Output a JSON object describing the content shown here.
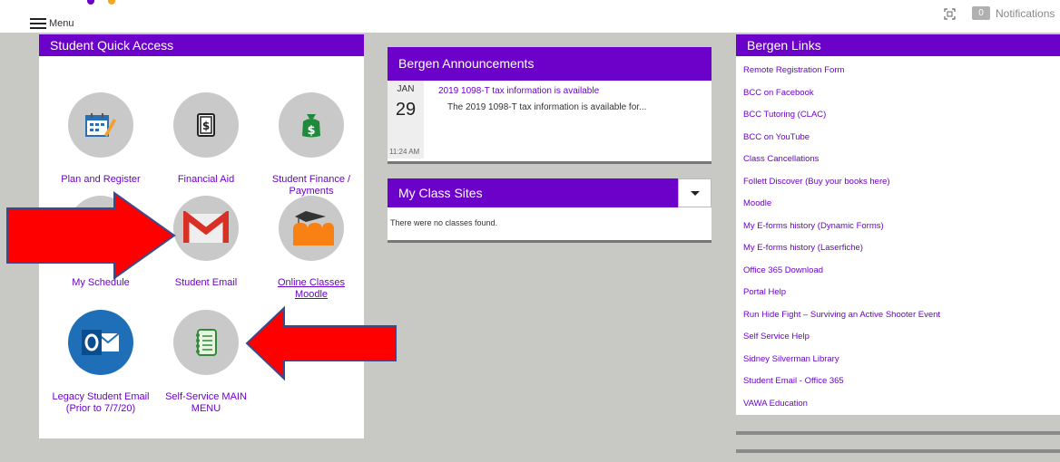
{
  "topbar": {
    "menu_label": "Menu",
    "notifications_count": "0",
    "notifications_label": "Notifications"
  },
  "quick_access": {
    "title": "Student Quick Access",
    "tiles": [
      {
        "label": "Plan and Register",
        "icon": "calendar-icon"
      },
      {
        "label": "Financial Aid",
        "icon": "money-document-icon"
      },
      {
        "label": "Student Finance / Payments",
        "icon": "money-bag-icon"
      },
      {
        "label": "My Schedule",
        "icon": "schedule-icon"
      },
      {
        "label": "Student Email",
        "icon": "gmail-icon"
      },
      {
        "label": "Online Classes Moodle",
        "icon": "moodle-icon"
      },
      {
        "label": "Legacy Student Email (Prior to 7/7/20)",
        "icon": "outlook-icon"
      },
      {
        "label": "Self-Service MAIN MENU",
        "icon": "notebook-icon"
      }
    ]
  },
  "announcements": {
    "title": "Bergen Announcements",
    "items": [
      {
        "month": "JAN",
        "day": "29",
        "time": "11:24 AM",
        "title": "2019 1098-T tax information is available",
        "body": "The 2019 1098-T tax information is available for..."
      }
    ]
  },
  "class_sites": {
    "title": "My Class Sites",
    "empty_text": "There were no classes found."
  },
  "links": {
    "title": "Bergen Links",
    "items": [
      "Remote Registration Form",
      "BCC on Facebook",
      "BCC Tutoring (CLAC)",
      "BCC on YouTube",
      "Class Cancellations",
      "Follett Discover (Buy your books here)",
      "Moodle",
      "My E-forms history (Dynamic Forms)",
      "My E-forms history (Laserfiche)",
      "Office 365 Download",
      "Portal Help",
      "Run Hide Fight – Surviving an Active Shooter Event",
      "Self Service Help",
      "Sidney Silverman Library",
      "Student Email - Office 365",
      "VAWA Education"
    ]
  },
  "colors": {
    "accent": "#6c02c9",
    "annotation_arrow": "#ff0000",
    "arrow_outline": "#3a4a8c"
  }
}
